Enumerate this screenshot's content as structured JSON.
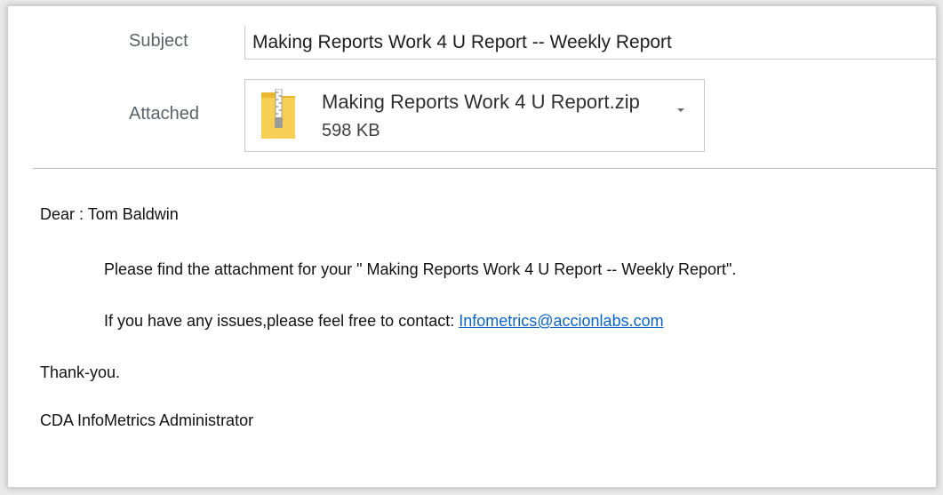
{
  "header": {
    "subject_label": "Subject",
    "subject_value": "Making Reports Work 4 U Report -- Weekly Report",
    "attached_label": "Attached"
  },
  "attachment": {
    "file_name": "Making Reports Work 4 U Report.zip",
    "file_size": "598 KB",
    "icon": "zip-folder-icon",
    "dropdown_icon": "chevron-down-icon"
  },
  "body": {
    "greeting": "Dear : Tom Baldwin",
    "para1": "Please find the attachment for your \" Making Reports Work 4 U Report -- Weekly Report\".",
    "para2_prefix": "If you have any issues,please feel free to contact: ",
    "contact_email": "Infometrics@accionlabs.com",
    "closing": "Thank-you.",
    "signature": "CDA InfoMetrics Administrator"
  },
  "colors": {
    "link": "#0b63c5",
    "label": "#5b6268",
    "zip_folder": "#f4c84a"
  }
}
